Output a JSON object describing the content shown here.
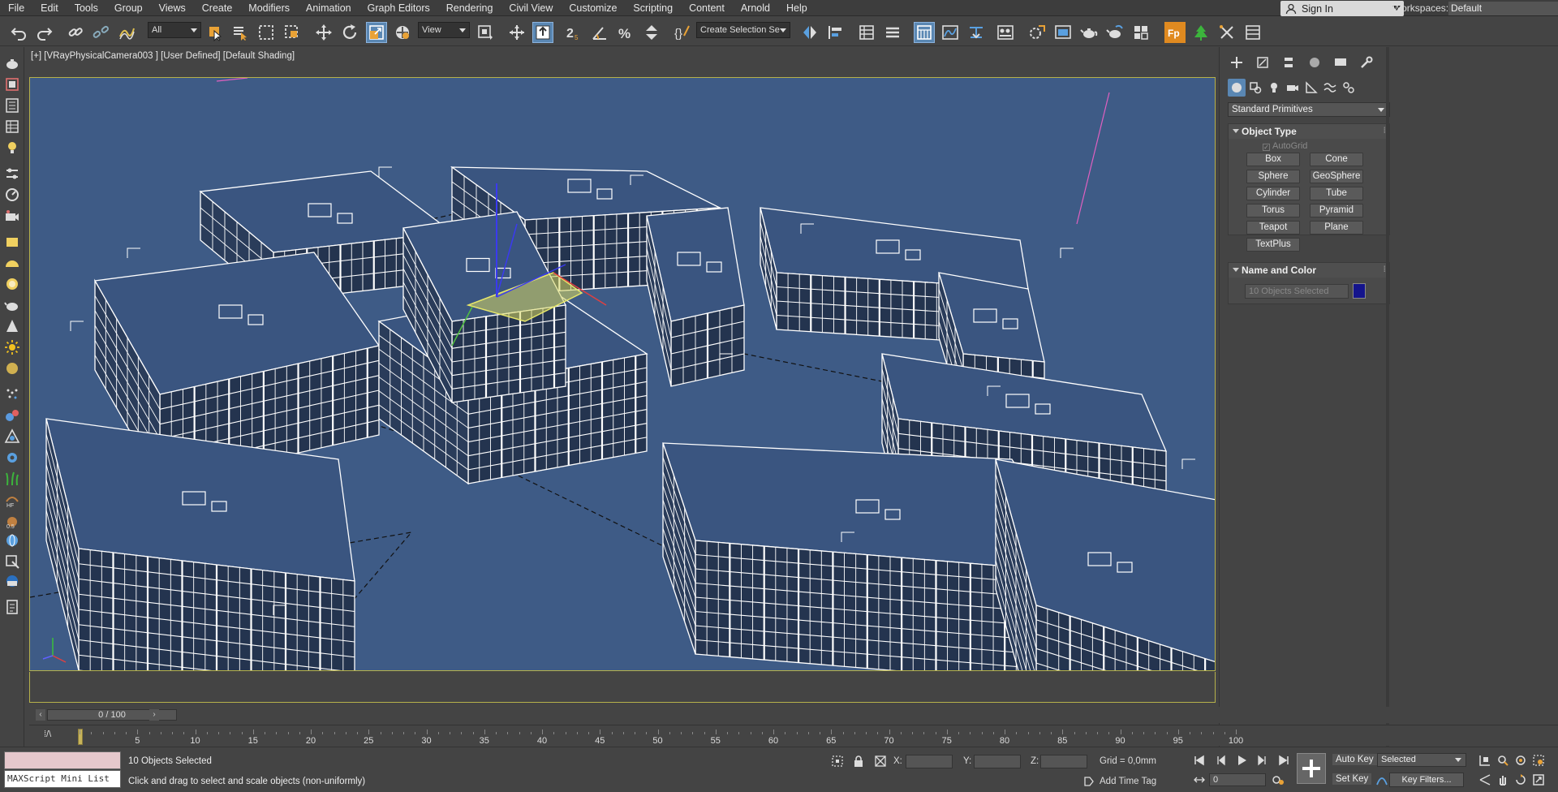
{
  "menu": [
    "File",
    "Edit",
    "Tools",
    "Group",
    "Views",
    "Create",
    "Modifiers",
    "Animation",
    "Graph Editors",
    "Rendering",
    "Civil View",
    "Customize",
    "Scripting",
    "Content",
    "Arnold",
    "Help"
  ],
  "signin": {
    "label": "Sign In"
  },
  "workspaces": {
    "label": "Workspaces:",
    "value": "Default"
  },
  "toolbar": {
    "filter": "All",
    "coord_system": "View",
    "selection_set": "Create Selection Se"
  },
  "viewport": {
    "label": "[+] [VRayPhysicalCamera003 ] [User Defined] [Default Shading]"
  },
  "command_panel": {
    "category": "Standard Primitives",
    "object_type": {
      "title": "Object Type",
      "autogrid": "AutoGrid",
      "buttons": [
        "Box",
        "Cone",
        "Sphere",
        "GeoSphere",
        "Cylinder",
        "Tube",
        "Torus",
        "Pyramid",
        "Teapot",
        "Plane",
        "TextPlus"
      ]
    },
    "name_color": {
      "title": "Name and Color",
      "name_value": "10 Objects Selected",
      "color": "#14148c"
    }
  },
  "time_slider": {
    "frame": "0 / 100"
  },
  "trackbar": {
    "ticks": [
      "5",
      "10",
      "15",
      "20",
      "25",
      "30",
      "35",
      "40",
      "45",
      "50",
      "55",
      "60",
      "65",
      "70",
      "75",
      "80",
      "85",
      "90",
      "95",
      "100"
    ]
  },
  "status": {
    "maxscript": "MAXScript Mini List",
    "selection": "10 Objects Selected",
    "prompt": "Click and drag to select and scale objects (non-uniformly)",
    "x_label": "X:",
    "y_label": "Y:",
    "z_label": "Z:",
    "grid": "Grid = 0,0mm",
    "add_time_tag": "Add Time Tag",
    "auto_key": "Auto Key",
    "set_key": "Set Key",
    "selected": "Selected",
    "frame_value": "0",
    "key_filters": "Key Filters..."
  }
}
